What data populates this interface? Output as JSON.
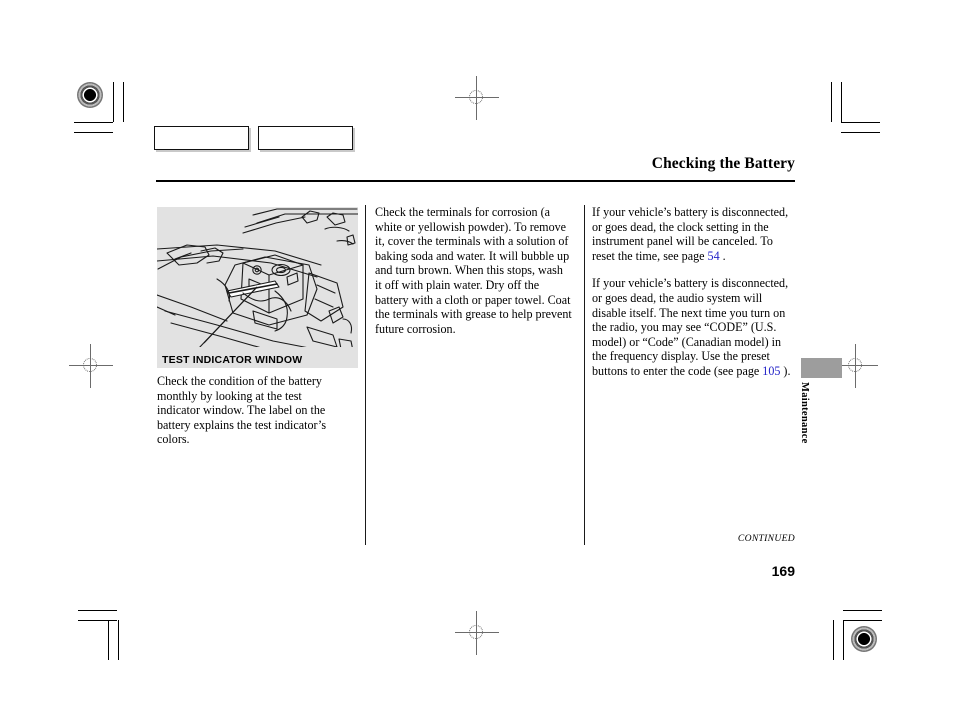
{
  "document": {
    "title": "Checking the Battery",
    "folio": "169",
    "continued_label": "CONTINUED",
    "side_tab_label": "Maintenance"
  },
  "figure": {
    "caption": "TEST INDICATOR WINDOW",
    "alt": "engine-bay-battery-line-drawing",
    "background_color": "#e2e2e2"
  },
  "columns": {
    "left": {
      "paragraphs": [
        "Check the condition of the battery monthly by looking at the test indicator window. The label on the battery explains the test indicator’s colors."
      ]
    },
    "middle": {
      "paragraphs": [
        "Check the terminals for corrosion (a white or yellowish powder). To remove it, cover the terminals with a solution of baking soda and water. It will bubble up and turn brown. When this stops, wash it off with plain water. Dry off the battery with a cloth or paper towel. Coat the terminals with grease to help prevent future corrosion."
      ]
    },
    "right": {
      "paragraph_1_before": "If your vehicle’s battery is disconnected, or goes dead, the clock setting in the instrument panel will be canceled. To reset the time, see page ",
      "paragraph_1_ref": "54",
      "paragraph_1_after": " .",
      "paragraph_2_before": "If your vehicle’s battery is disconnected, or goes dead, the audio system will disable itself. The next time you turn on the radio, you may see “CODE” (U.S. model) or “Code” (Canadian model) in the frequency display. Use the preset buttons to enter the code (see page ",
      "paragraph_2_ref": "105",
      "paragraph_2_after": " )."
    }
  },
  "print_marks": {
    "swatch_boxes": [
      "",
      ""
    ],
    "accent_color": "#2323c8",
    "registration_color": "#6b6b6b"
  }
}
